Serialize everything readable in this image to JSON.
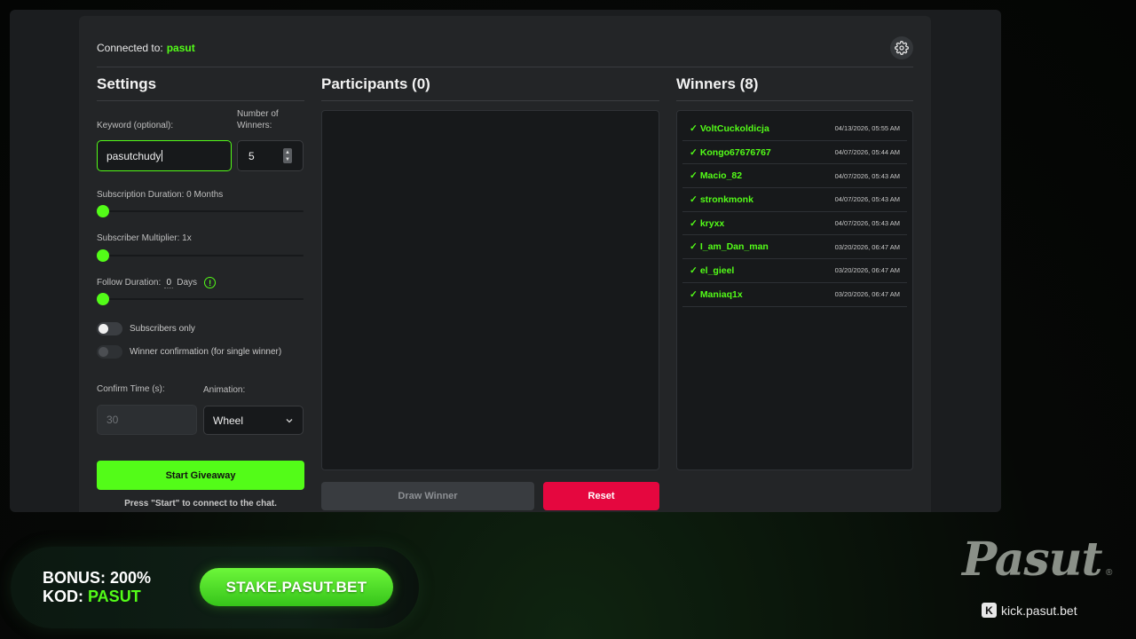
{
  "header": {
    "connected_label": "Connected to:",
    "channel": "pasut"
  },
  "settings": {
    "title": "Settings",
    "keyword_label": "Keyword (optional):",
    "keyword_value": "pasutchudy",
    "winners_count_label": "Number of Winners:",
    "winners_count_value": "5",
    "sub_duration_label": "Subscription Duration: 0 Months",
    "sub_duration_value": 0,
    "sub_multiplier_label": "Subscriber Multiplier: 1x",
    "sub_multiplier_value": 1,
    "follow_label_prefix": "Follow Duration:",
    "follow_value": "0",
    "follow_unit": "Days",
    "subscribers_only_label": "Subscribers only",
    "subscribers_only": false,
    "winner_confirmation_label": "Winner confirmation (for single winner)",
    "winner_confirmation": false,
    "confirm_time_label": "Confirm Time (s):",
    "confirm_time_placeholder": "30",
    "animation_label": "Animation:",
    "animation_value": "Wheel",
    "start_button": "Start Giveaway",
    "hint": "Press \"Start\" to connect to the chat."
  },
  "participants": {
    "title": "Participants (0)",
    "draw_button": "Draw Winner",
    "reset_button": "Reset"
  },
  "winners": {
    "title": "Winners (8)",
    "items": [
      {
        "name": "VoltCuckoldicja",
        "time": "04/13/2026, 05:55 AM"
      },
      {
        "name": "Kongo67676767",
        "time": "04/07/2026, 05:44 AM"
      },
      {
        "name": "Macio_82",
        "time": "04/07/2026, 05:43 AM"
      },
      {
        "name": "stronkmonk",
        "time": "04/07/2026, 05:43 AM"
      },
      {
        "name": "kryxx",
        "time": "04/07/2026, 05:43 AM"
      },
      {
        "name": "I_am_Dan_man",
        "time": "03/20/2026, 06:47 AM"
      },
      {
        "name": "el_gieel",
        "time": "03/20/2026, 06:47 AM"
      },
      {
        "name": "Maniaq1x",
        "time": "03/20/2026, 06:47 AM"
      }
    ]
  },
  "promo": {
    "bonus_label": "BONUS:",
    "bonus_value": "200%",
    "code_label": "KOD:",
    "code_value": "PASUT",
    "stake_button": "STAKE.PASUT.BET"
  },
  "brand": {
    "logo": "Pasut",
    "reg": "®",
    "kick_url": "kick.pasut.bet",
    "kick_icon_letter": "K"
  },
  "colors": {
    "accent": "#53fc18",
    "danger": "#e5073f",
    "panel": "#232527",
    "field": "#17191b"
  }
}
